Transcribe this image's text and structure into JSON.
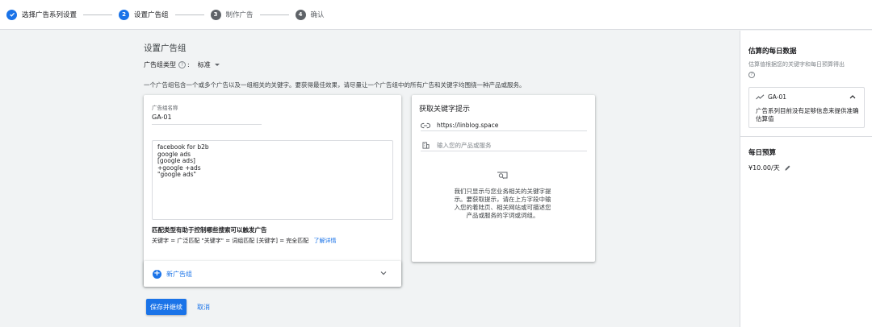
{
  "stepper": {
    "steps": [
      {
        "number": "",
        "label": "选择广告系列设置",
        "state": "done"
      },
      {
        "number": "2",
        "label": "设置广告组",
        "state": "active"
      },
      {
        "number": "3",
        "label": "制作广告",
        "state": "pending"
      },
      {
        "number": "4",
        "label": "确认",
        "state": "pending"
      }
    ]
  },
  "main": {
    "title": "设置广告组",
    "type_label": "广告组类型",
    "type_help": "?",
    "type_value": "标准",
    "description": "一个广告组包含一个或多个广告以及一组相关的关键字。要获得最佳效果，请尽量让一个广告组中的所有广告和关键字均围绕一种产品或服务。",
    "group_name_label": "广告组名称",
    "group_name_value": "GA-01",
    "keywords": [
      "facebook for b2b",
      "google ads",
      "[google ads]",
      "+google +ads",
      "\"google ads\""
    ],
    "match_title": "匹配类型有助于控制哪些搜索可以触发广告",
    "match_rule": "关键字 = 广泛匹配  \"关键字\" = 词组匹配  [关键字] = 完全匹配",
    "learn_more": "了解详情",
    "new_group_label": "新广告组",
    "save_button": "保存并继续",
    "cancel_button": "取消"
  },
  "suggestions": {
    "title": "获取关键字提示",
    "url_value": "https://linblog.space",
    "product_placeholder": "输入您的产品或服务",
    "empty_text": "我们只显示与您业务相关的关键字提示。要获取提示，请在上方字段中输入您的着陆页、相关网站或可描述您产品或服务的字词或词组。"
  },
  "sidebar": {
    "title": "估算的每日数据",
    "description": "估算值根据您的关键字和每日预算得出",
    "help": "?",
    "group_card_name": "GA-01",
    "group_card_text": "广告系列目前没有足够信息来提供准确估算值",
    "budget_title": "每日预算",
    "budget_value": "¥10.00/天"
  },
  "colors": {
    "accent": "#1a73e8",
    "pending_step": "#5f6368",
    "background": "#f1f3f4"
  }
}
